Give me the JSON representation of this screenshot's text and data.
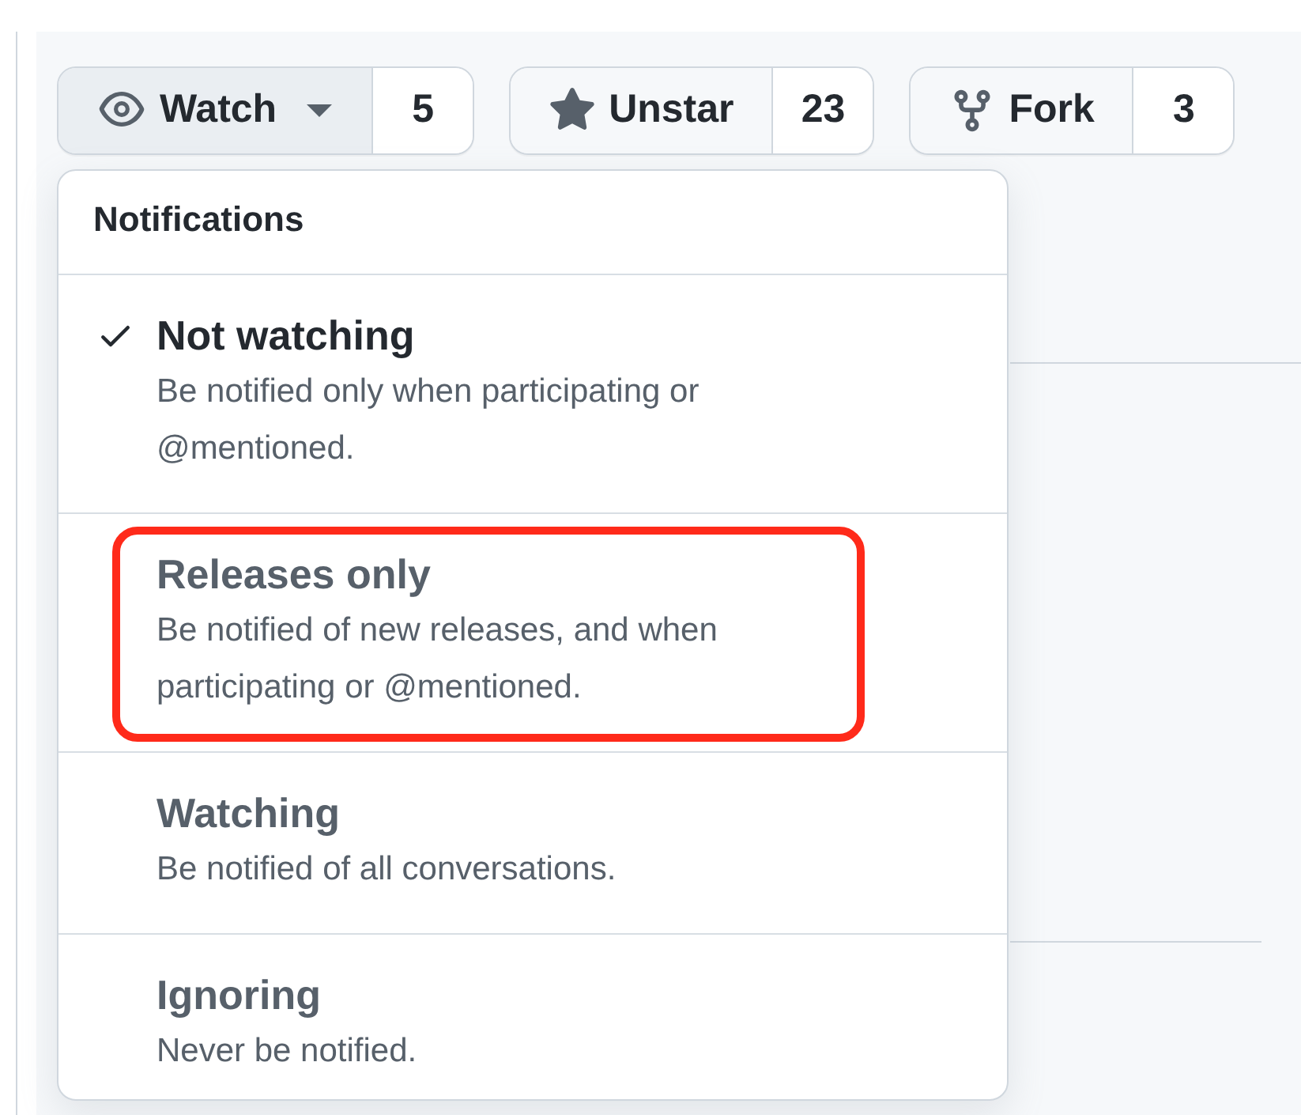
{
  "actions": [
    {
      "kind": "watch",
      "label": "Watch",
      "count": "5",
      "open": true
    },
    {
      "kind": "star",
      "label": "Unstar",
      "count": "23",
      "open": false
    },
    {
      "kind": "fork",
      "label": "Fork",
      "count": "3",
      "open": false
    }
  ],
  "menu": {
    "title": "Notifications",
    "items": [
      {
        "title": "Not watching",
        "description": "Be notified only when participating or @mentioned.",
        "selected": true,
        "highlighted": false
      },
      {
        "title": "Releases only",
        "description": "Be notified of new releases, and when participating or @mentioned.",
        "selected": false,
        "highlighted": true
      },
      {
        "title": "Watching",
        "description": "Be notified of all conversations.",
        "selected": false,
        "highlighted": false
      },
      {
        "title": "Ignoring",
        "description": "Never be notified.",
        "selected": false,
        "highlighted": false
      }
    ]
  }
}
